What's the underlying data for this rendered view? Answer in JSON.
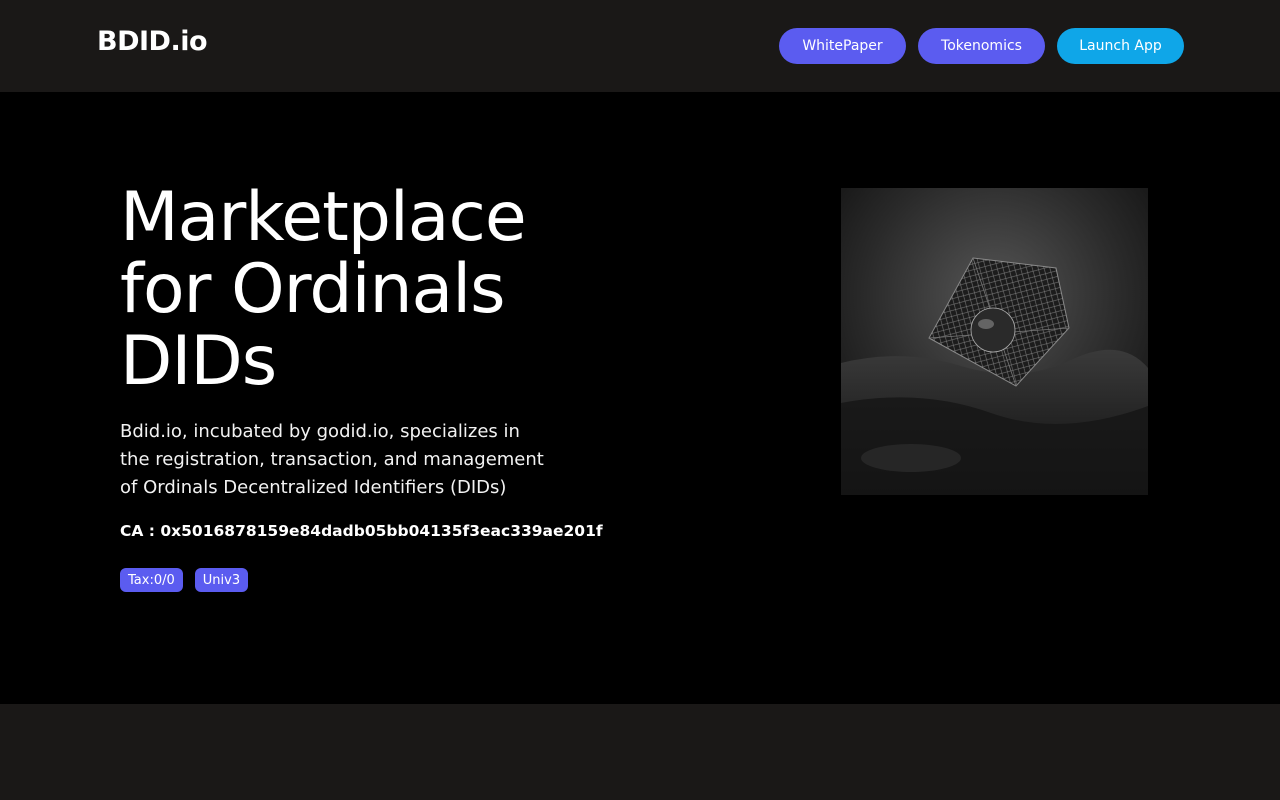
{
  "header": {
    "logo": "BDID.io",
    "nav": {
      "whitepaper": "WhitePaper",
      "tokenomics": "Tokenomics",
      "launch_app": "Launch App"
    }
  },
  "hero": {
    "title_lines": [
      "Marketplace",
      "for Ordinals",
      "DIDs"
    ],
    "description": "Bdid.io, incubated by godid.io, specializes in the registration, transaction, and management of Ordinals Decentralized Identifiers (DIDs)",
    "contract": "CA : 0x5016878159e84dadb05bb04135f3eac339ae201f",
    "badges": {
      "tax": "Tax:0/0",
      "univ": "Univ3"
    },
    "image_icon": "floating-wireframe-cube-landscape"
  },
  "colors": {
    "header_bg": "#1a1817",
    "hero_bg": "#000000",
    "accent_purple": "#5b5cf0",
    "accent_blue": "#0fa6e8"
  }
}
